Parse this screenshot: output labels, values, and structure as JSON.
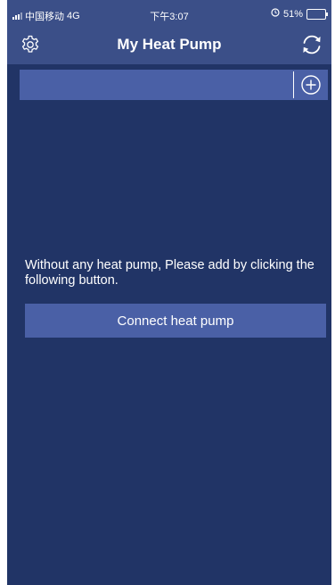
{
  "status_bar": {
    "carrier": "中国移动",
    "network": "4G",
    "time": "下午3:07",
    "battery": "51%",
    "battery_level": 0.51,
    "battery_color": "#4cd964"
  },
  "header": {
    "title": "My Heat Pump",
    "left_icon": "gear-icon",
    "right_icon": "refresh-icon"
  },
  "device_bar": {
    "add_icon": "plus-circle-icon"
  },
  "main": {
    "empty_message": "Without any heat pump, Please add by clicking the following button.",
    "connect_button_label": "Connect heat pump"
  },
  "colors": {
    "background": "#213466",
    "header": "#3b4f88",
    "accent": "#4a60a6",
    "text": "#ffffff"
  }
}
